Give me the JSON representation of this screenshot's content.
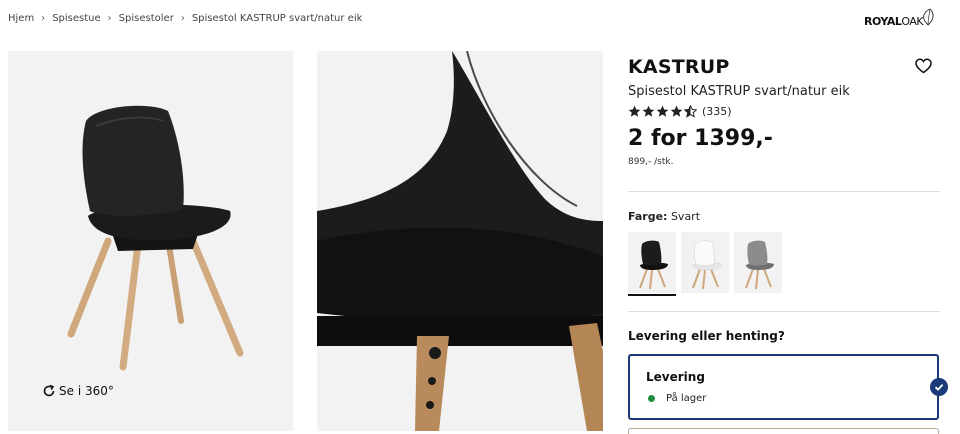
{
  "breadcrumb": {
    "items": [
      "Hjem",
      "Spisestue",
      "Spisestoler",
      "Spisestol KASTRUP svart/natur eik"
    ],
    "separator": "›"
  },
  "brand": {
    "logo_bold": "ROYAL",
    "logo_thin": "OAK"
  },
  "gallery": {
    "rotate_label": "Se i 360°"
  },
  "product": {
    "title": "KASTRUP",
    "subtitle": "Spisestol KASTRUP svart/natur eik",
    "rating_value": 4.5,
    "rating_count": "(335)",
    "price": "2 for 1399,-",
    "unit_price": "899,- /stk."
  },
  "color": {
    "label": "Farge:",
    "value": "Svart",
    "options": [
      {
        "name": "Svart",
        "seat": "#1c1c1c",
        "pad": "#111111"
      },
      {
        "name": "Hvit",
        "seat": "#f7f7f7",
        "pad": "#e9e9e9"
      },
      {
        "name": "Grå",
        "seat": "#8a8a8a",
        "pad": "#6f6f6f"
      }
    ],
    "selected_index": 0
  },
  "delivery": {
    "question": "Levering eller henting?",
    "option_title": "Levering",
    "stock_text": "På lager",
    "stock_color": "#1e8c3a",
    "accent": "#1a3a7a"
  }
}
